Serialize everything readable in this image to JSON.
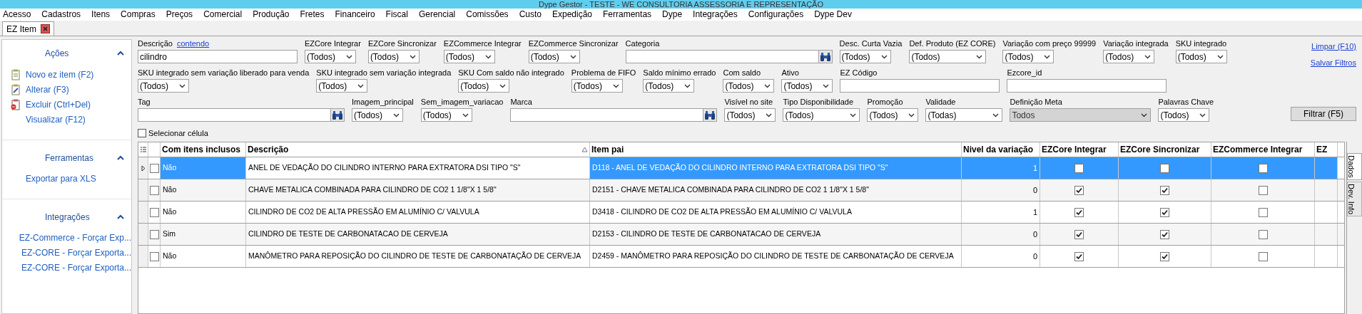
{
  "window": {
    "title": "Dype Gestor - TESTE - WE CONSULTORIA ASSESSORIA E REPRESENTAÇÃO"
  },
  "menu": [
    "Acesso",
    "Cadastros",
    "Itens",
    "Compras",
    "Preços",
    "Comercial",
    "Produção",
    "Fretes",
    "Financeiro",
    "Fiscal",
    "Gerencial",
    "Comissões",
    "Custo",
    "Expedição",
    "Ferramentas",
    "Dype",
    "Integrações",
    "Configurações",
    "Dype Dev"
  ],
  "tabs": [
    {
      "label": "EZ Item",
      "selected": true
    }
  ],
  "sidebar": {
    "sections": [
      {
        "title": "Ações",
        "expanded": true,
        "items": [
          {
            "label": "Novo ez item (F2)",
            "kind": "add"
          },
          {
            "label": "Alterar (F3)",
            "kind": "edit"
          },
          {
            "label": "Excluir (Ctrl+Del)",
            "kind": "delete"
          },
          {
            "label": "Visualizar (F12)",
            "kind": "plain"
          }
        ]
      },
      {
        "title": "Ferramentas",
        "expanded": true,
        "items": [
          {
            "label": "Exportar para XLS",
            "kind": "plain"
          }
        ]
      },
      {
        "title": "Integrações",
        "expanded": true,
        "items": [
          {
            "label": "EZ-Commerce - Forçar Exp...",
            "kind": "plain"
          },
          {
            "label": "EZ-CORE - Forçar Exporta...",
            "kind": "plain"
          },
          {
            "label": "EZ-CORE - Forçar Exporta...",
            "kind": "plain"
          }
        ]
      }
    ]
  },
  "filters": {
    "rows": [
      [
        {
          "label": "Descrição",
          "link": "contendo",
          "kind": "text",
          "value": "cilindro",
          "disabled": false
        },
        {
          "label": "EZCore Integrar",
          "kind": "select",
          "value": "(Todos)",
          "disabled": false
        },
        {
          "label": "EZCore Sincronizar",
          "kind": "select",
          "value": "(Todos)",
          "disabled": false
        },
        {
          "label": "EZCommerce Integrar",
          "kind": "select",
          "value": "(Todos)",
          "disabled": false
        },
        {
          "label": "EZCommerce Sincronizar",
          "kind": "select",
          "value": "(Todos)",
          "disabled": false
        },
        {
          "label": "Categoria",
          "kind": "search",
          "disabled": false
        },
        {
          "label": "Desc. Curta Vazia",
          "kind": "select",
          "value": "(Todos)",
          "disabled": false
        },
        {
          "label": "Def. Produto (EZ CORE)",
          "kind": "select-wide",
          "value": "(Todos)",
          "disabled": false
        },
        {
          "label": "Variação com preço 99999",
          "kind": "select",
          "value": "(Todos)",
          "disabled": false
        },
        {
          "label": "Variação integrada",
          "kind": "select",
          "value": "(Todos)",
          "disabled": false
        },
        {
          "label": "SKU integrado",
          "kind": "select",
          "value": "(Todos)",
          "disabled": false
        }
      ],
      [
        {
          "label": "SKU integrado sem variação liberado para venda",
          "kind": "select",
          "value": "(Todos)",
          "disabled": false
        },
        {
          "label": "SKU integrado sem variação integrada",
          "kind": "select",
          "value": "(Todos)",
          "disabled": false
        },
        {
          "label": "SKU Com saldo não integrado",
          "kind": "select",
          "value": "(Todos)",
          "disabled": false
        },
        {
          "label": "Problema de FIFO",
          "kind": "select",
          "value": "(Todos)",
          "disabled": false
        },
        {
          "label": "Saldo mínimo errado",
          "kind": "select",
          "value": "(Todos)",
          "disabled": false
        },
        {
          "label": "Com saldo",
          "kind": "select",
          "value": "(Todos)",
          "disabled": false
        },
        {
          "label": "Ativo",
          "kind": "select",
          "value": "(Todos)",
          "disabled": false
        },
        {
          "label": "EZ Código",
          "kind": "text",
          "disabled": false
        },
        {
          "label": "Ezcore_id",
          "kind": "text",
          "disabled": false
        }
      ],
      [
        {
          "label": "Tag",
          "kind": "search",
          "disabled": false
        },
        {
          "label": "Imagem_principal",
          "kind": "select",
          "value": "(Todos)",
          "disabled": false
        },
        {
          "label": "Sem_imagem_variacao",
          "kind": "select",
          "value": "(Todos)",
          "disabled": false
        },
        {
          "label": "Marca",
          "kind": "search",
          "disabled": false
        },
        {
          "label": "Visível no site",
          "kind": "select",
          "value": "(Todos)",
          "disabled": false
        },
        {
          "label": "Tipo Disponibilidade",
          "kind": "select-wide",
          "value": "(Todos)",
          "disabled": false
        },
        {
          "label": "Promoção",
          "kind": "select",
          "value": "(Todos)",
          "disabled": false
        },
        {
          "label": "Validade",
          "kind": "select-wide",
          "value": "(Todas)",
          "disabled": false
        },
        {
          "label": "Definição Meta",
          "kind": "select-xl",
          "value": "Todos",
          "disabled": true
        },
        {
          "label": "Palavras Chave",
          "kind": "select",
          "value": "(Todos)",
          "disabled": false
        }
      ]
    ],
    "links": [
      "Limpar (F10)",
      "Salvar Filtros"
    ],
    "button": "Filtrar (F5)"
  },
  "grid": {
    "select_cell": {
      "label": "Selecionar célula",
      "checked": false
    },
    "columns": [
      {
        "label": "Com itens inclusos",
        "kind": "text",
        "sorted": false
      },
      {
        "label": "Descrição",
        "kind": "text",
        "sorted": true
      },
      {
        "label": "Item pai",
        "kind": "text",
        "sorted": false
      },
      {
        "label": "Nivel da variação",
        "kind": "number",
        "sorted": false
      },
      {
        "label": "EZCore Integrar",
        "kind": "check",
        "sorted": false
      },
      {
        "label": "EZCore Sincronizar",
        "kind": "check",
        "sorted": false
      },
      {
        "label": "EZCommerce Integrar",
        "kind": "check",
        "sorted": false
      },
      {
        "label": "EZ",
        "kind": "cut",
        "sorted": false
      }
    ],
    "rows": [
      {
        "selected": true,
        "checked": false,
        "cells": [
          "Não",
          "ANEL DE VEDAÇÃO DO CILINDRO INTERNO PARA EXTRATORA DSI TIPO \"S\"",
          "D118 - ANEL DE VEDAÇÃO DO CILINDRO INTERNO PARA EXTRATORA DSI TIPO \"S\"",
          "1",
          false,
          false,
          false
        ]
      },
      {
        "selected": false,
        "checked": false,
        "cells": [
          "Não",
          "CHAVE METALICA COMBINADA PARA CILINDRO DE CO2 1 1/8\"X 1 5/8\"",
          "D2151 - CHAVE METALICA COMBINADA PARA CILINDRO DE CO2 1 1/8\"X 1 5/8\"",
          "0",
          true,
          true,
          false
        ]
      },
      {
        "selected": false,
        "checked": false,
        "cells": [
          "Não",
          "CILINDRO DE CO2 DE ALTA PRESSÃO EM ALUMÍNIO C/ VALVULA",
          "D3418 - CILINDRO DE CO2 DE ALTA PRESSÃO EM ALUMÍNIO C/ VALVULA",
          "1",
          true,
          true,
          false
        ]
      },
      {
        "selected": false,
        "checked": false,
        "cells": [
          "Sim",
          "CILINDRO DE TESTE DE CARBONATACAO DE CERVEJA",
          "D2153 - CILINDRO DE TESTE DE CARBONATACAO DE CERVEJA",
          "0",
          true,
          true,
          false
        ]
      },
      {
        "selected": false,
        "checked": false,
        "cells": [
          "Não",
          "MANÔMETRO PARA REPOSIÇÃO DO CILINDRO DE TESTE DE CARBONATAÇÃO DE CERVEJA",
          "D2459 - MANÔMETRO PARA REPOSIÇÃO DO CILINDRO DE TESTE DE CARBONATAÇÃO DE CERVEJA",
          "0",
          true,
          true,
          false
        ]
      }
    ]
  },
  "side_tabs": [
    {
      "label": "Dados",
      "selected": true
    },
    {
      "label": "Dev. Info",
      "selected": false
    }
  ]
}
